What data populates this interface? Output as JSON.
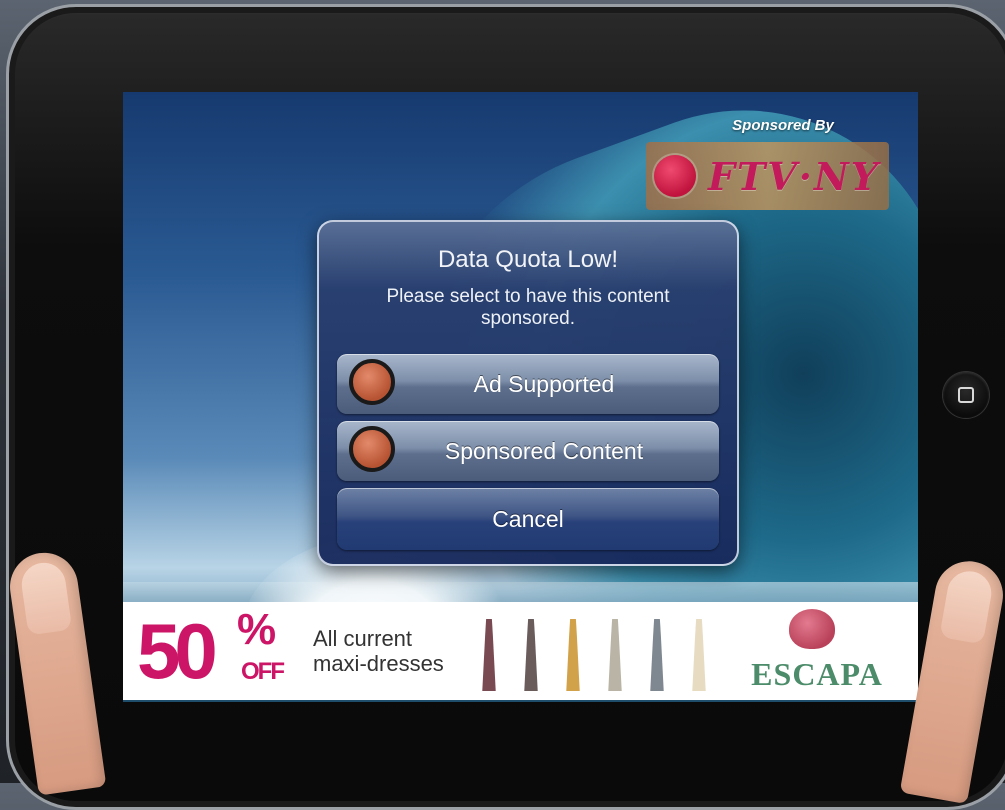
{
  "sponsor": {
    "label": "Sponsored By",
    "name": "FTV·NY",
    "dot_color": "#d01a4a"
  },
  "dialog": {
    "title": "Data Quota Low!",
    "message": "Please select to have this content sponsored.",
    "buttons": [
      {
        "label": "Ad Supported",
        "icon": "radio-button-icon"
      },
      {
        "label": "Sponsored Content",
        "icon": "radio-button-icon"
      },
      {
        "label": "Cancel"
      }
    ]
  },
  "ad": {
    "percent": "50",
    "percent_sign": "%",
    "off": "OFF",
    "line1": "All current",
    "line2": "maxi-dresses",
    "brand": "ESCAPA",
    "accent": "#cc1566",
    "brand_color": "#4c8c6a",
    "dress_colors": [
      "#7a4a52",
      "#6b5c5c",
      "#d2a24a",
      "#b9b4a5",
      "#7f8790",
      "#e7dcc2"
    ]
  },
  "device": {
    "home_button": "home-button-icon"
  }
}
